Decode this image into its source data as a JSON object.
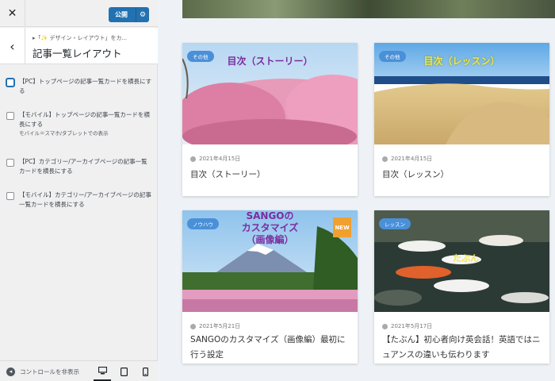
{
  "toolbar": {
    "close_icon": "close-icon",
    "publish_label": "公開",
    "publish_gear_icon": "gear-icon"
  },
  "section": {
    "breadcrumb": "▸「✨ デザイン・レイアウト」をカ...",
    "title": "記事一覧レイアウト"
  },
  "options": [
    {
      "label": "【PC】トップページの記事一覧カードを横長にする",
      "checked": false
    },
    {
      "label": "【モバイル】トップページの記事一覧カードを横長にする",
      "desc": "モバイル＝スマホ/タブレットでの表示",
      "checked": false
    },
    {
      "label": "【PC】カテゴリー/アーカイブページの記事一覧カードを横長にする",
      "checked": false
    },
    {
      "label": "【モバイル】カテゴリー/アーカイブページの記事一覧カードを横長にする",
      "checked": false
    }
  ],
  "footer": {
    "hide_controls_label": "コントロールを非表示",
    "devices": [
      "desktop",
      "tablet",
      "mobile"
    ],
    "active_device": "desktop"
  },
  "cards": [
    {
      "category": "その他",
      "thumb_text": "目次（ストーリー）",
      "date": "2021年4月15日",
      "title": "目次（ストーリー）",
      "new": false
    },
    {
      "category": "その他",
      "thumb_text": "目次（レッスン）",
      "date": "2021年4月15日",
      "title": "目次（レッスン）",
      "new": false
    },
    {
      "category": "ノウハウ",
      "thumb_text": "SANGOの\nカスタマイズ\n（画像編）",
      "date": "2021年5月21日",
      "title": "SANGOのカスタマイズ（画像編）最初に行う設定",
      "new": true,
      "new_label": "NEW"
    },
    {
      "category": "レッスン",
      "thumb_text": "たぶん",
      "date": "2021年5月17日",
      "title": "【たぶん】初心者向け英会話！英語ではニュアンスの違いも伝わります",
      "new": false
    }
  ],
  "colors": {
    "accent": "#2271b1",
    "category_badge": "#4a90d9",
    "new_badge": "#f0a030"
  }
}
